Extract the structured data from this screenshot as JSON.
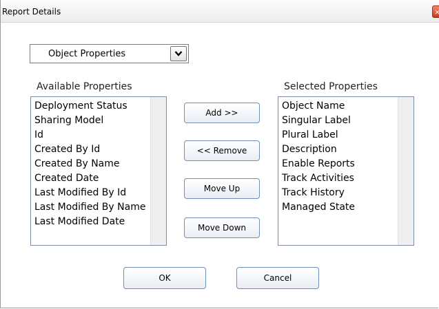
{
  "window": {
    "title": "Report Details",
    "close_glyph": "×"
  },
  "object_select": {
    "selected": "Object Properties",
    "icon": "chevron-down-icon"
  },
  "available": {
    "label": "Available Properties",
    "items": [
      "Deployment Status",
      "Sharing Model",
      "Id",
      "Created By Id",
      "Created By Name",
      "Created Date",
      "Last Modified By Id",
      "Last Modified By Name",
      "Last Modified Date"
    ]
  },
  "selected": {
    "label": "Selected Properties",
    "items": [
      "Object Name",
      "Singular Label",
      "Plural Label",
      "Description",
      "Enable Reports",
      "Track Activities",
      "Track History",
      "Managed State"
    ]
  },
  "actions": {
    "add": "Add >>",
    "remove": "<< Remove",
    "move_up": "Move Up",
    "move_down": "Move Down"
  },
  "footer": {
    "ok": "OK",
    "cancel": "Cancel"
  }
}
